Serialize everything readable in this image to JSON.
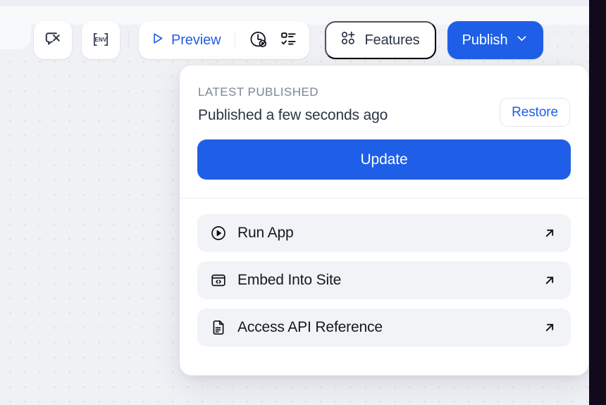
{
  "colors": {
    "accent_blue": "#1f5fe8",
    "canvas_bg": "#eff1f5",
    "panel_bg": "#ffffff",
    "list_item_bg": "#f1f3f7",
    "muted_text": "#7b8598",
    "dark_rail": "#120a1c"
  },
  "toolbar": {
    "icon_buttons": [
      {
        "name": "chat-dismiss-icon",
        "title": "Dismiss chat"
      },
      {
        "name": "env-icon",
        "title": "ENV",
        "text": "ENV"
      }
    ],
    "preview": {
      "label": "Preview",
      "play_icon": "play-triangle-icon",
      "history_icon": "clock-play-history-icon",
      "checklist_icon": "checklist-icon"
    },
    "features": {
      "label": "Features",
      "icon": "add-circles-grid-icon"
    },
    "publish": {
      "label": "Publish",
      "chevron": "chevron-down-icon"
    }
  },
  "panel": {
    "section_label": "LATEST PUBLISHED",
    "status_text": "Published a few seconds ago",
    "restore_label": "Restore",
    "update_label": "Update",
    "items": [
      {
        "label": "Run App",
        "icon": "play-circle-icon",
        "external": "arrow-up-right-icon"
      },
      {
        "label": "Embed Into Site",
        "icon": "embed-code-window-icon",
        "external": "arrow-up-right-icon"
      },
      {
        "label": "Access API Reference",
        "icon": "document-lines-icon",
        "external": "arrow-up-right-icon"
      }
    ]
  }
}
